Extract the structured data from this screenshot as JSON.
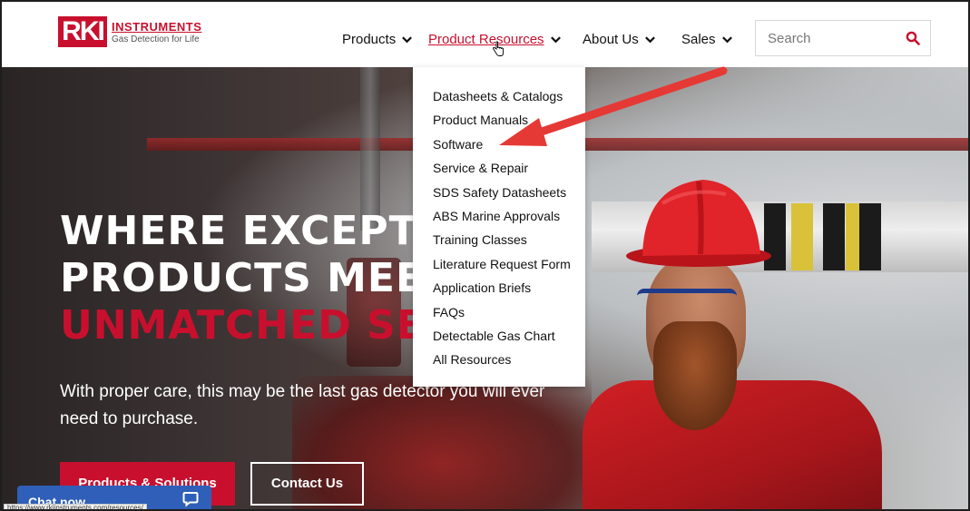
{
  "logo": {
    "mark": "RKI",
    "name": "INSTRUMENTS",
    "tagline": "Gas Detection for Life"
  },
  "nav": {
    "products": "Products",
    "product_resources": "Product Resources",
    "about": "About Us",
    "sales": "Sales"
  },
  "search": {
    "placeholder": "Search"
  },
  "dropdown": {
    "items": [
      "Datasheets & Catalogs",
      "Product Manuals",
      "Software",
      "Service & Repair",
      "SDS Safety Datasheets",
      "ABS Marine Approvals",
      "Training Classes",
      "Literature Request Form",
      "Application Briefs",
      "FAQs",
      "Detectable Gas Chart",
      "All Resources"
    ]
  },
  "hero": {
    "title_line1": "WHERE EXCEPTIONAL",
    "title_line2": "PRODUCTS MEET",
    "title_line3": "UNMATCHED SERVICE",
    "subtitle": "With proper care, this may be the last gas detector you will ever need to purchase.",
    "primary_button": "Products & Solutions",
    "secondary_button": "Contact Us"
  },
  "chat": {
    "label": "Chat now"
  },
  "status_bar": {
    "url": "https://www.rkiinstruments.com/resources/"
  },
  "colors": {
    "brand_red": "#c8102e",
    "chat_blue": "#2f5fb8",
    "annotation_arrow": "#e53935"
  }
}
